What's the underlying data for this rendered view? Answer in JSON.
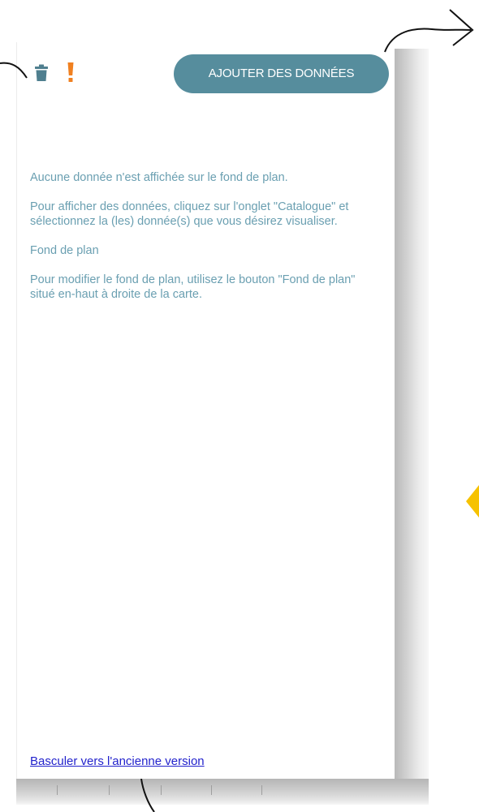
{
  "toolbar": {
    "add_data_label": "AJOUTER DES DONNÉES",
    "icons": [
      "trash-icon",
      "alert-icon"
    ],
    "accent_color": "#568d9d",
    "alert_color": "#f08020"
  },
  "main": {
    "paragraphs": [
      "Aucune donnée n'est affichée sur le fond de plan.",
      "Pour afficher des données, cliquez sur l'onglet \"Catalogue\" et sélectionnez la (les) donnée(s) que vous désirez visualiser.",
      "Fond de plan",
      "Pour modifier le fond de plan, utilisez le bouton \"Fond de plan\" situé en-haut à droite de la carte."
    ],
    "text_color": "#6a9fb1"
  },
  "footer": {
    "switch_version_link": "Basculer vers l'ancienne version"
  }
}
